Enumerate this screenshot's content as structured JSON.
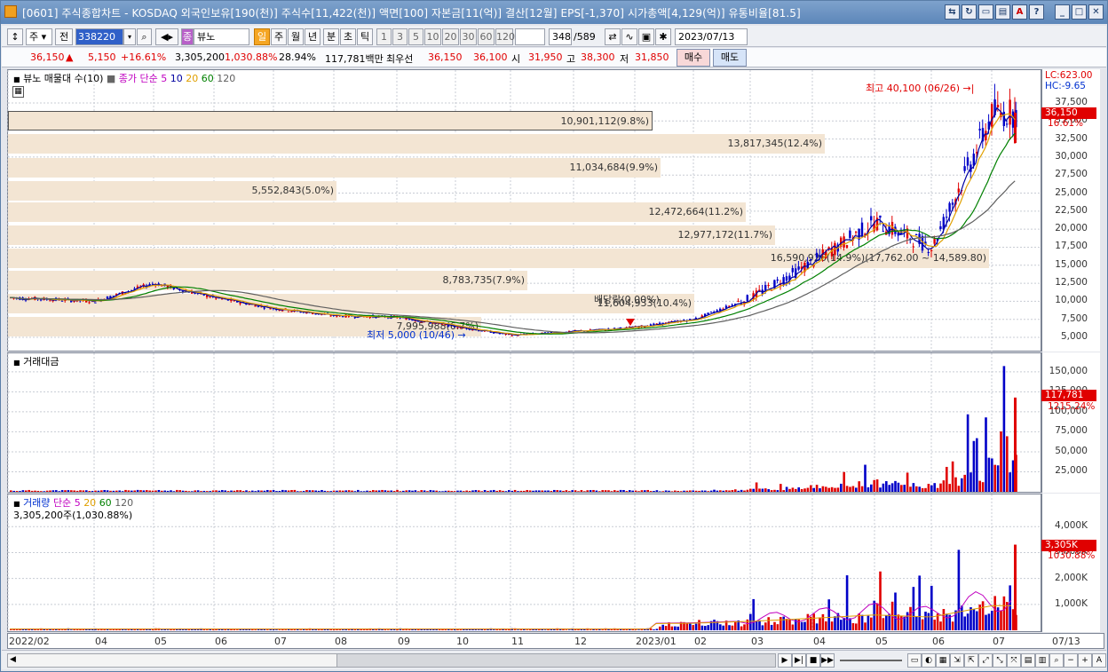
{
  "window": {
    "title": "[0601] 주식종합차트 - KOSDAQ 외국인보유[190(천)] 주식수[11,422(천)] 액면[100] 자본금[11(억)] 결산[12월] EPS[-1,370] 시가총액[4,129(억)] 유통비율[81.5]"
  },
  "toolbar": {
    "type_select": "주",
    "prev_label": "전",
    "code": "338220",
    "stock_name": "뷰노",
    "periods": [
      "일",
      "주",
      "월",
      "년",
      "분",
      "초",
      "틱"
    ],
    "intervals": [
      "1",
      "3",
      "5",
      "10",
      "20",
      "30",
      "60",
      "120"
    ],
    "count": "348",
    "total": "/589",
    "date": "2023/07/13"
  },
  "quote": {
    "price": "36,150",
    "change": "5,150",
    "change_pct": "+16.61%",
    "volume": "3,305,200",
    "volume_pct": "1,030.88%",
    "turnover_pct": "28.94%",
    "trade_value": "117,781백만",
    "best_ask_label": "최우선",
    "best_ask": "36,150",
    "best_bid": "36,100",
    "open_label": "시",
    "open": "31,950",
    "high_label": "고",
    "high": "38,300",
    "low_label": "저",
    "low": "31,850",
    "buy_label": "매수",
    "sell_label": "매도"
  },
  "price_pane": {
    "title": "뷰노 매물대 수(10)",
    "ma_label": "종가 단순",
    "ma_periods": [
      "5",
      "10",
      "20",
      "60",
      "120"
    ],
    "lc_label": "LC:623.00",
    "hc_label": "HC:-9.65",
    "high_note": "최고 40,100 (06/26)",
    "low_note": "최저 5,000 (10/46)",
    "dividend_note": "배당락(0.00%)",
    "price_tag": "36,150",
    "price_tag_pct": "16.61%",
    "y_ticks": [
      "37,500",
      "35,000",
      "32,500",
      "30,000",
      "27,500",
      "25,000",
      "22,500",
      "20,000",
      "17,500",
      "15,000",
      "12,500",
      "10,000",
      "7,500",
      "5,000"
    ],
    "volume_profile": [
      "10,901,112(9.8%)",
      "13,817,345(12.4%)",
      "11,034,684(9.9%)",
      "5,552,843(5.0%)",
      "12,472,664(11.2%)",
      "12,977,172(11.7%)",
      "16,590,926(14.9%)(17,762.00 ~ 14,589.80)",
      "8,783,735(7.9%)",
      "11,604,933(10.4%)",
      "7,995,988(6.7%)"
    ],
    "colors": {
      "up": "#e00000",
      "down": "#0000c8",
      "ma5": "#c000c0",
      "ma10": "#0000a0",
      "ma20": "#e0a000",
      "ma60": "#008000",
      "ma120": "#606060"
    }
  },
  "value_pane": {
    "title": "거래대금",
    "y_ticks": [
      "150,000",
      "125,000",
      "100,000",
      "75,000",
      "50,000",
      "25,000"
    ],
    "tag_value": "117,781",
    "tag_pct": "1215.24%"
  },
  "volume_pane": {
    "title": "거래량",
    "ma_label": "단순",
    "ma_periods": [
      "5",
      "20",
      "60",
      "120"
    ],
    "sub": "3,305,200주(1,030.88%)",
    "y_ticks": [
      "4,000K",
      "3,000K",
      "2,000K",
      "1,000K"
    ],
    "tag_value": "3,305K",
    "tag_pct": "1030.88%"
  },
  "x_axis": {
    "labels": [
      "2022/02",
      "04",
      "05",
      "06",
      "07",
      "08",
      "09",
      "10",
      "11",
      "12",
      "2023/01",
      "02",
      "03",
      "04",
      "05",
      "06",
      "07"
    ],
    "right_label": "07/13"
  },
  "chart_data": {
    "type": "candlestick",
    "title": "뷰노 매물대 수(10)",
    "x_range": [
      "2022/02",
      "2023/07/13"
    ],
    "ylim": [
      4000,
      40500
    ],
    "high": {
      "value": 40100,
      "date": "06/26"
    },
    "low": {
      "value": 5000
    },
    "last": {
      "close": 36150,
      "open": 31950,
      "high": 38300,
      "low": 31850
    },
    "price_path": [
      [
        "2022/02",
        10500
      ],
      [
        "2022/03",
        10000
      ],
      [
        "2022/04",
        12500
      ],
      [
        "2022/05",
        10500
      ],
      [
        "2022/06",
        9000
      ],
      [
        "2022/07",
        8000
      ],
      [
        "2022/08",
        7800
      ],
      [
        "2022/09",
        6500
      ],
      [
        "2022/10",
        5300
      ],
      [
        "2022/11",
        5800
      ],
      [
        "2022/12",
        6400
      ],
      [
        "2023/01",
        7500
      ],
      [
        "2023/02",
        10500
      ],
      [
        "2023/03",
        15500
      ],
      [
        "2023/04",
        21000
      ],
      [
        "2023/05",
        17500
      ],
      [
        "2023/06",
        36000
      ],
      [
        "2023/07",
        36150
      ]
    ],
    "volume_profile": [
      {
        "range_top": 37500,
        "volume": 10901112,
        "pct": 9.8
      },
      {
        "range_top": 33900,
        "volume": 13817345,
        "pct": 12.4
      },
      {
        "range_top": 30300,
        "volume": 11034684,
        "pct": 9.9
      },
      {
        "range_top": 26700,
        "volume": 5552843,
        "pct": 5.0
      },
      {
        "range_top": 23100,
        "volume": 12472664,
        "pct": 11.2
      },
      {
        "range_top": 19500,
        "volume": 12977172,
        "pct": 11.7
      },
      {
        "range_top": 17762,
        "volume": 16590926,
        "pct": 14.9
      },
      {
        "range_top": 12300,
        "volume": 8783735,
        "pct": 7.9
      },
      {
        "range_top": 8700,
        "volume": 11604933,
        "pct": 10.4
      },
      {
        "range_top": 5100,
        "volume": 7995988,
        "pct": 6.7
      }
    ]
  }
}
